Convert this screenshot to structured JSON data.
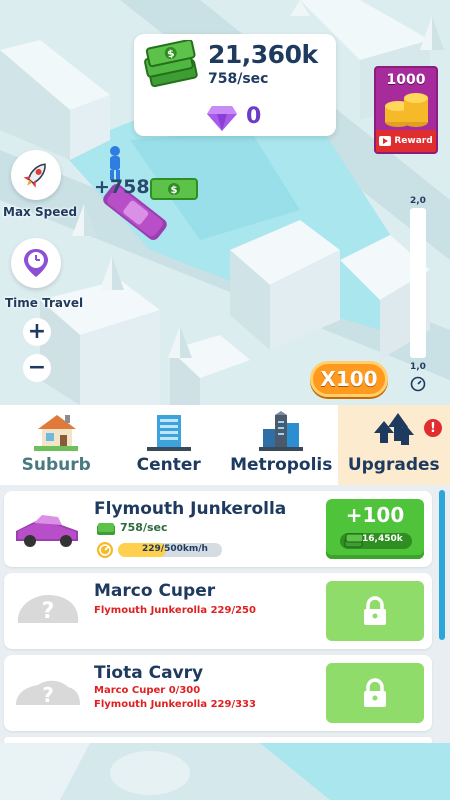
{
  "hud": {
    "cash": "21,360k",
    "cash_rate": "758/sec",
    "gems": "0"
  },
  "reward": {
    "amount": "1000",
    "label": "Reward"
  },
  "controls": {
    "max_speed_label": "Max Speed",
    "time_travel_label": "Time Travel",
    "zoom_in": "+",
    "zoom_out": "−",
    "speed_top": "2,0",
    "speed_bottom": "1,0",
    "speed_level": 0.0,
    "multiplier": "X100"
  },
  "map": {
    "floating_income": "+758"
  },
  "tabs": [
    {
      "label": "Suburb"
    },
    {
      "label": "Center"
    },
    {
      "label": "Metropolis"
    },
    {
      "label": "Upgrades",
      "alert": "!"
    }
  ],
  "upgrades": [
    {
      "name": "Flymouth Junkerolla",
      "rate": "758/sec",
      "speed": "229/500km/h",
      "speed_fraction": 0.458,
      "buy_amount": "+100",
      "buy_cost": "16,450k"
    },
    {
      "name": "Marco Cuper",
      "requirements": [
        "Flymouth Junkerolla 229/250"
      ]
    },
    {
      "name": "Tiota Cavry",
      "requirements": [
        "Marco Cuper 0/300",
        "Flymouth Junkerolla 229/333"
      ]
    }
  ],
  "colors": {
    "accent": "#1e3a5f",
    "water": "#9fe3ec",
    "buy_green": "#4fc43b",
    "locked_green": "#8fdc6a",
    "multiplier_orange": "#ff9a1f",
    "requirement_red": "#e02020",
    "car_purple": "#b84fc9"
  },
  "icons": [
    "cash-stack-icon",
    "gem-icon",
    "rocket-icon",
    "clock-pin-icon",
    "speedometer-icon",
    "lock-icon",
    "video-icon",
    "coin-stack-icon"
  ]
}
